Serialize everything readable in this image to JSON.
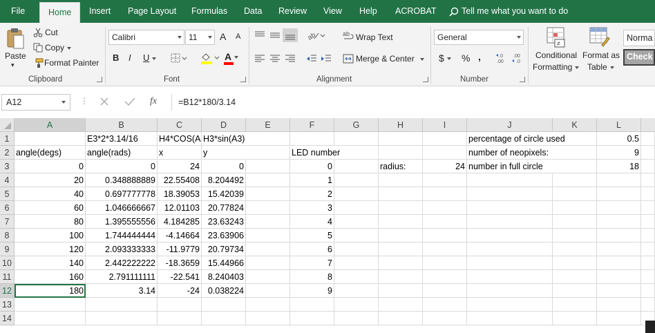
{
  "menu": {
    "tabs": [
      {
        "label": "File"
      },
      {
        "label": "Home"
      },
      {
        "label": "Insert"
      },
      {
        "label": "Page Layout"
      },
      {
        "label": "Formulas"
      },
      {
        "label": "Data"
      },
      {
        "label": "Review"
      },
      {
        "label": "View"
      },
      {
        "label": "Help"
      },
      {
        "label": "ACROBAT"
      }
    ],
    "tell_me": "Tell me what you want to do"
  },
  "ribbon": {
    "clipboard": {
      "paste": "Paste",
      "cut": "Cut",
      "copy": "Copy",
      "format_painter": "Format Painter",
      "label": "Clipboard"
    },
    "font": {
      "name": "Calibri",
      "size": "11",
      "grow": "A",
      "shrink": "A",
      "bold": "B",
      "italic": "I",
      "underline": "U",
      "font_color_letter": "A",
      "label": "Font",
      "highlight_color": "#ffff00",
      "font_color": "#ff0000"
    },
    "alignment": {
      "wrap_text": "Wrap Text",
      "merge_center": "Merge & Center",
      "label": "Alignment"
    },
    "number": {
      "format": "General",
      "currency": "$",
      "percent": "%",
      "comma": ",",
      "label": "Number"
    },
    "styles": {
      "conditional_line1": "Conditional",
      "conditional_line2": "Formatting",
      "format_as_line1": "Format as",
      "format_as_line2": "Table",
      "style_normal": "Norma",
      "style_check": "Check"
    }
  },
  "formula_bar": {
    "name_box": "A12",
    "fx": "fx",
    "formula": "=B12*180/3.14"
  },
  "grid": {
    "columns": [
      "A",
      "B",
      "C",
      "D",
      "E",
      "F",
      "G",
      "H",
      "I",
      "J",
      "K",
      "L"
    ],
    "rows": [
      "1",
      "2",
      "3",
      "4",
      "5",
      "6",
      "7",
      "8",
      "9",
      "10",
      "11",
      "12",
      "13",
      "14"
    ],
    "cells": {
      "B1": "E3*2*3.14/16",
      "C1": "H4*COS(A",
      "D1": "H3*sin(A3)",
      "J1": "percentage of circle used",
      "L1": "0.5",
      "A2": "angle(degs)",
      "B2": "angle(rads)",
      "C2": "x",
      "D2": "y",
      "F2": "LED number",
      "J2": "number of neopixels:",
      "L2": "9",
      "A3": "0",
      "B3": "0",
      "C3": "24",
      "D3": "0",
      "F3": "0",
      "H3": "radius:",
      "I3": "24",
      "J3": "number in full circle",
      "L3": "18",
      "A4": "20",
      "B4": "0.348888889",
      "C4": "22.55408",
      "D4": "8.204492",
      "F4": "1",
      "A5": "40",
      "B5": "0.697777778",
      "C5": "18.39053",
      "D5": "15.42039",
      "F5": "2",
      "A6": "60",
      "B6": "1.046666667",
      "C6": "12.01103",
      "D6": "20.77824",
      "F6": "3",
      "A7": "80",
      "B7": "1.395555556",
      "C7": "4.184285",
      "D7": "23.63243",
      "F7": "4",
      "A8": "100",
      "B8": "1.744444444",
      "C8": "-4.14664",
      "D8": "23.63906",
      "F8": "5",
      "A9": "120",
      "B9": "2.093333333",
      "C9": "-11.9779",
      "D9": "20.79734",
      "F9": "6",
      "A10": "140",
      "B10": "2.442222222",
      "C10": "-18.3659",
      "D10": "15.44966",
      "F10": "7",
      "A11": "160",
      "B11": "2.791111111",
      "C11": "-22.541",
      "D11": "8.240403",
      "F11": "8",
      "A12": "180",
      "B12": "3.14",
      "C12": "-24",
      "D12": "0.038224",
      "F12": "9"
    },
    "selected_cell": "A12"
  },
  "colors": {
    "accent": "#217346",
    "ribbon_bg": "#f3f3f3",
    "header_bg": "#e6e6e6"
  }
}
